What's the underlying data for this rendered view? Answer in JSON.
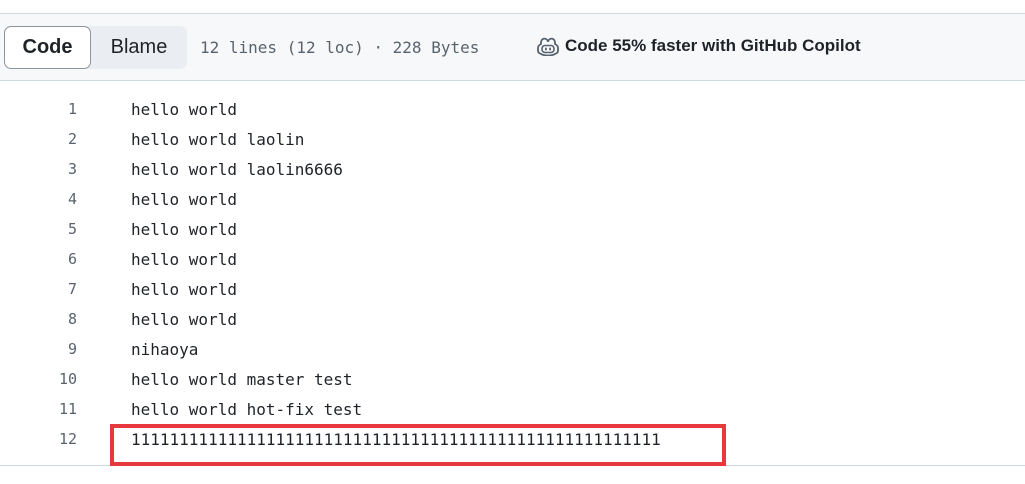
{
  "toolbar": {
    "code_label": "Code",
    "blame_label": "Blame",
    "file_meta": "12 lines (12 loc) · 228 Bytes",
    "copilot_label": "Code 55% faster with GitHub Copilot",
    "copilot_icon": "copilot-icon"
  },
  "lines": [
    {
      "number": "1",
      "text": "hello world"
    },
    {
      "number": "2",
      "text": "hello world laolin"
    },
    {
      "number": "3",
      "text": "hello world laolin6666"
    },
    {
      "number": "4",
      "text": "hello world"
    },
    {
      "number": "5",
      "text": "hello world"
    },
    {
      "number": "6",
      "text": "hello world"
    },
    {
      "number": "7",
      "text": "hello world"
    },
    {
      "number": "8",
      "text": "hello world"
    },
    {
      "number": "9",
      "text": "nihaoya"
    },
    {
      "number": "10",
      "text": "hello world master test"
    },
    {
      "number": "11",
      "text": "hello world hot-fix test"
    },
    {
      "number": "12",
      "text": "1111111111111111111111111111111111111111111111111111111"
    }
  ],
  "colors": {
    "highlight": "#e8373d",
    "toolbar_bg": "#f6f8fa",
    "border": "#d0d7de"
  }
}
